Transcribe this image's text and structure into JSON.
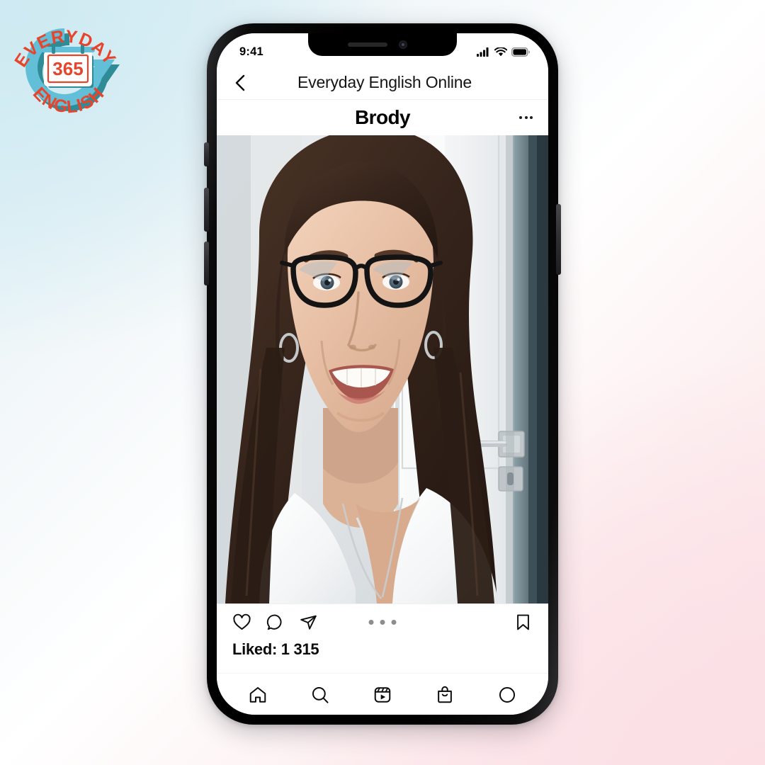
{
  "brand_logo": {
    "arc_top_text": "EVERYDAY",
    "arc_bottom_text": "ENGLISH",
    "calendar_number": "365",
    "colors": {
      "red": "#E8442B",
      "blue": "#63BFD8",
      "teal_shadow": "#2F8C97",
      "card_white": "#FFFFFF"
    }
  },
  "phone": {
    "status_bar": {
      "time": "9:41",
      "cellular_icon": "cellular-bars-icon",
      "wifi_icon": "wifi-icon",
      "battery_icon": "battery-full-icon"
    },
    "nav_header": {
      "back_icon": "chevron-left-icon",
      "title": "Everyday English Online"
    },
    "post_header": {
      "username": "Brody",
      "more_icon": "more-options-icon"
    },
    "photo": {
      "alt": "selfie-portrait-woman-glasses",
      "description": "Smiling woman with long dark brown hair, black-framed glasses, silver hoop earrings and necklace, wearing a white shirt, standing in front of a white door with a silver handle"
    },
    "action_bar": {
      "like_icon": "heart-icon",
      "comment_icon": "comment-bubble-icon",
      "share_icon": "share-paper-plane-icon",
      "save_icon": "bookmark-icon",
      "carousel_dots": 3
    },
    "likes": {
      "label": "Liked: 1 315"
    },
    "bottom_nav": [
      {
        "name": "home",
        "icon": "home-icon"
      },
      {
        "name": "search",
        "icon": "search-icon"
      },
      {
        "name": "reels",
        "icon": "reels-icon"
      },
      {
        "name": "shop",
        "icon": "shop-bag-icon"
      },
      {
        "name": "profile",
        "icon": "profile-avatar-icon"
      }
    ]
  },
  "background": {
    "gradient_from": "#d8eff5",
    "gradient_mid": "#ffffff",
    "gradient_to": "#fbe3e8"
  }
}
